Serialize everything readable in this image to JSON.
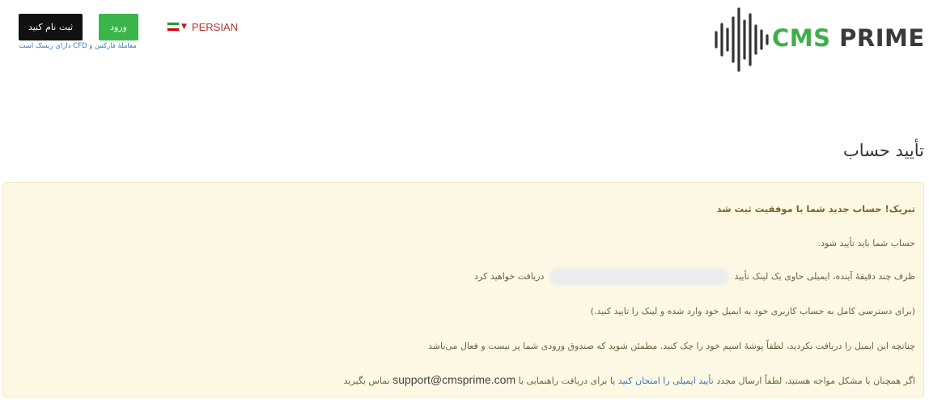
{
  "header": {
    "register_label": "ثبت نام کنید",
    "login_label": "ورود",
    "risk_text": "معاملهٔ فارکس و CFD دارای ریسک است",
    "language": "PERSIAN",
    "language_flag": "iran-flag-icon",
    "logo": {
      "part1": "CMS",
      "part2": "PRIME",
      "icon": "sound-wave-logo-icon"
    }
  },
  "page": {
    "title": "تأیید حساب"
  },
  "alert": {
    "heading": "تبریک! حساب جدید شما با موفقیت ثبت شد",
    "line1": "حساب شما باید تأیید شود.",
    "line2_before": "ظرف چند دقیقهٔ آینده، ایمیلی حاوی یک لینک تأیید",
    "line2_after": "دریافت خواهید کرد",
    "line3": "(برای دسترسی کامل به حساب کاربری خود به ایمیل خود وارد شده و لینک را تایید کنید.)",
    "line4": "چنانچه این ایمیل را دریافت نکردید، لطفاً پوشهٔ اسپم خود را چک کنید. مطمئن شوید که صندوق ورودی شما پر نیست و فعال می‌باشد",
    "line5_a": "اگر همچنان با مشکل مواجه هستید، لطفاً ارسال مجدد",
    "line5_link": "تأیید ایمیلی را امتحان کنید",
    "line5_b": "یا برای دریافت راهنمایی با",
    "support_email": "support@cmsprime.com",
    "line5_c": "تماس بگیرید"
  },
  "colors": {
    "brand_green": "#3fae49",
    "login_green": "#3bb54a",
    "alert_bg": "#fcf8e3",
    "link_blue": "#3b73b9",
    "lang_red": "#b5312e"
  }
}
